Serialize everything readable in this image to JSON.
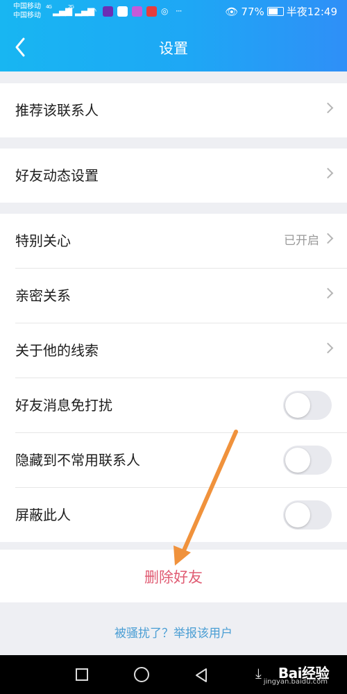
{
  "status_bar": {
    "carrier_1": "中国移动",
    "carrier_2": "中国移动",
    "net_1": "4G",
    "net_2": "2G",
    "battery": "77%",
    "time": "半夜12:49"
  },
  "header": {
    "title": "设置",
    "back_icon": "chevron-left-icon"
  },
  "groups": [
    [
      {
        "label": "推荐该联系人",
        "control": "chevron"
      }
    ],
    [
      {
        "label": "好友动态设置",
        "control": "chevron"
      }
    ],
    [
      {
        "label": "特别关心",
        "value": "已开启",
        "control": "chevron"
      },
      {
        "label": "亲密关系",
        "control": "chevron"
      },
      {
        "label": "关于他的线索",
        "control": "chevron"
      },
      {
        "label": "好友消息免打扰",
        "control": "toggle",
        "on": false
      },
      {
        "label": "隐藏到不常用联系人",
        "control": "toggle",
        "on": false
      },
      {
        "label": "屏蔽此人",
        "control": "toggle",
        "on": false
      }
    ]
  ],
  "delete_button": {
    "label": "删除好友",
    "color": "#e05c73"
  },
  "report_link": {
    "label": "被骚扰了？举报该用户",
    "color": "#4a9ed4"
  },
  "annotation": {
    "color": "#f0923c",
    "icon": "annotation-arrow"
  },
  "navbar": {
    "watermark": "Bai经验",
    "watermark_url": "jingyan.baidu.com"
  },
  "colors": {
    "header_start": "#18b6f2",
    "header_end": "#2f8ff7",
    "background": "#eeeff3"
  }
}
